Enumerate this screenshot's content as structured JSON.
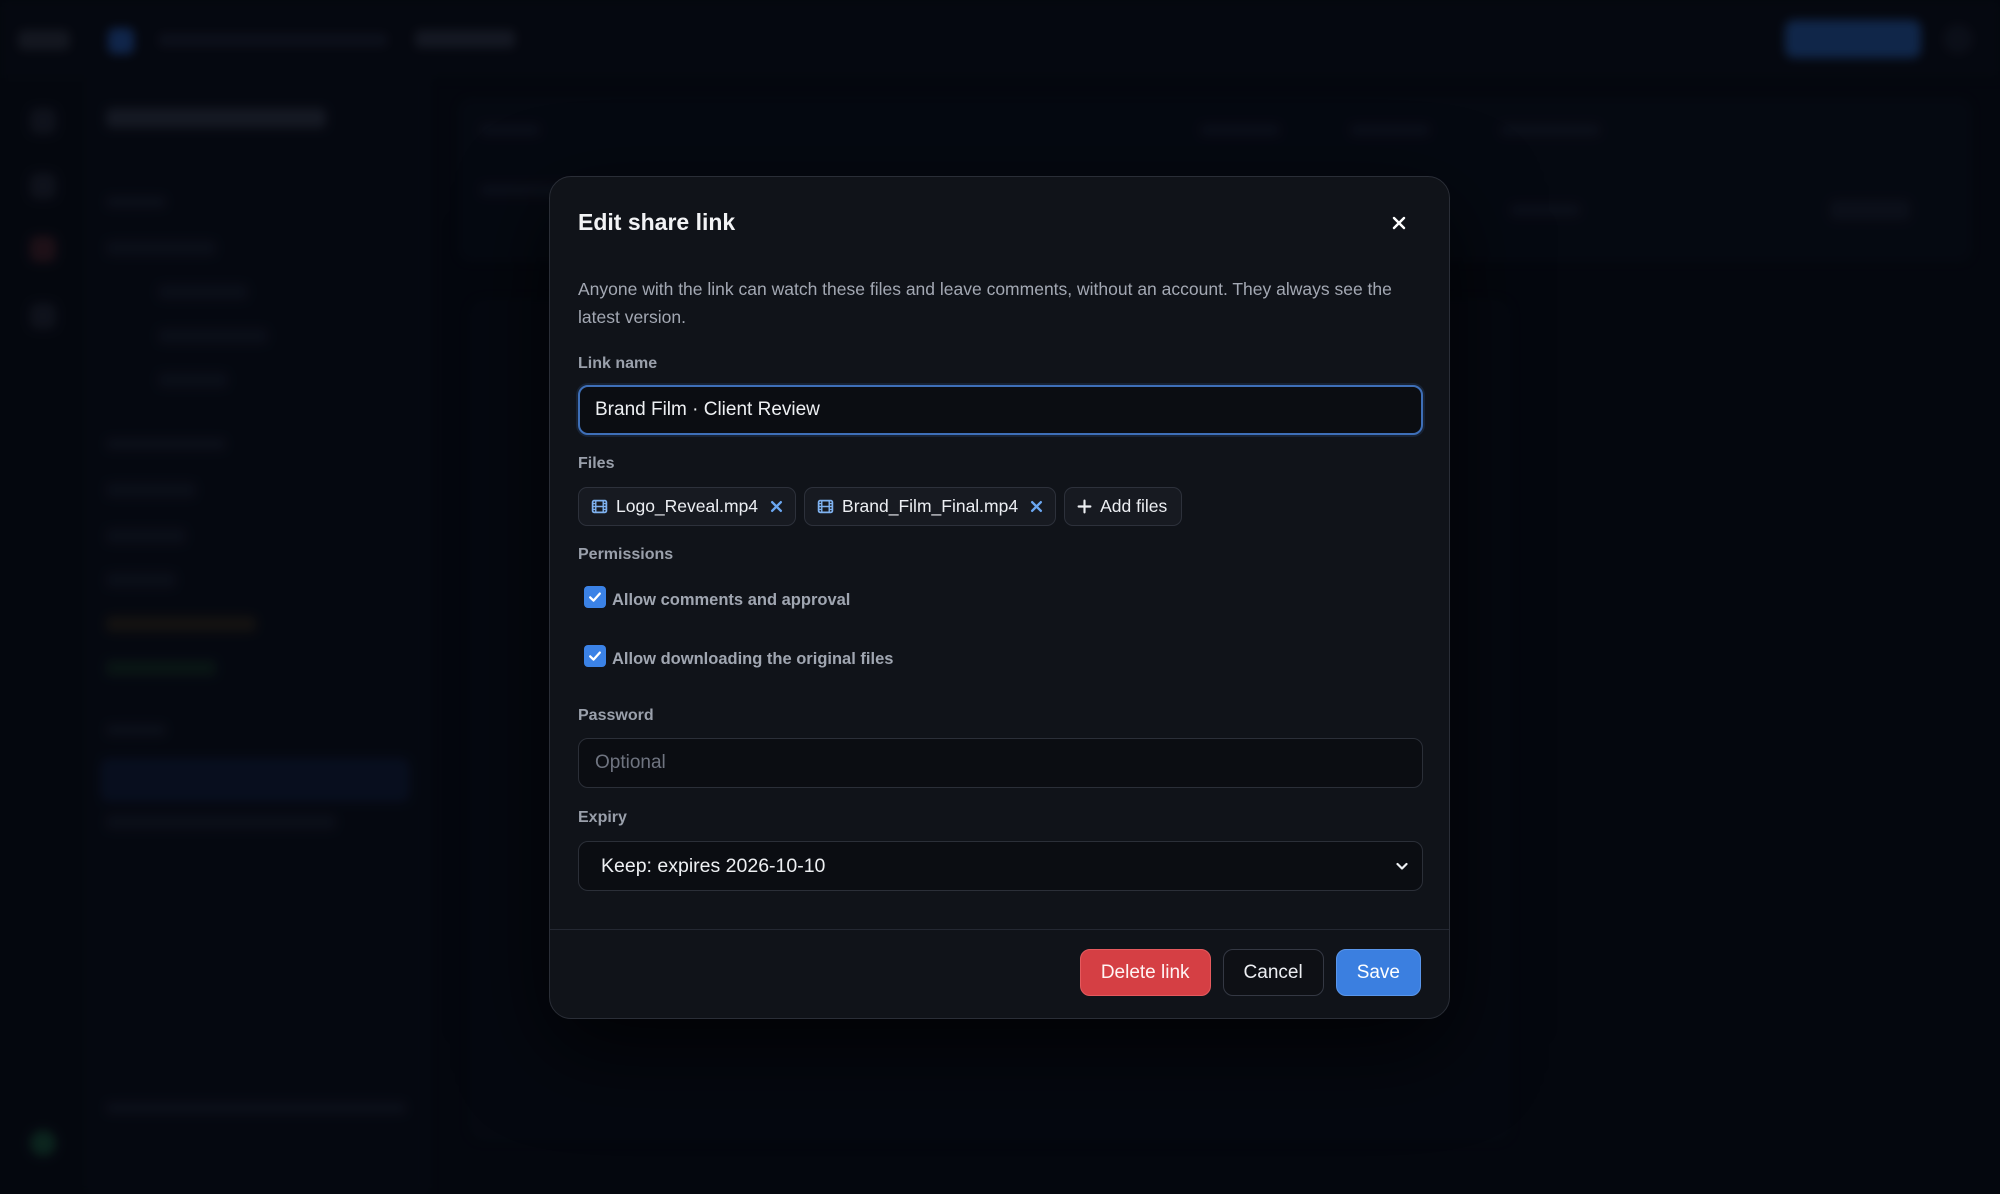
{
  "modal": {
    "title": "Edit share link",
    "description": "Anyone with the link can watch these files and leave comments, without an account. They always see the latest version.",
    "link_name": {
      "label": "Link name",
      "value": "Brand Film · Client Review"
    },
    "files": {
      "label": "Files",
      "items": [
        {
          "name": "Logo_Reveal.mp4"
        },
        {
          "name": "Brand_Film_Final.mp4"
        }
      ],
      "add_label": "Add files"
    },
    "permissions": {
      "label": "Permissions",
      "options": [
        {
          "label": "Allow comments and approval",
          "checked": true
        },
        {
          "label": "Allow downloading the original files",
          "checked": true
        }
      ]
    },
    "password": {
      "label": "Password",
      "value": "",
      "placeholder": "Optional"
    },
    "expiry": {
      "label": "Expiry",
      "selected": "Keep: expires 2026-10-10"
    },
    "actions": {
      "delete": "Delete link",
      "cancel": "Cancel",
      "save": "Save"
    }
  },
  "colors": {
    "accent": "#3b7fe0",
    "danger": "#d53f44",
    "surface": "#101319",
    "backdrop": "#070a12",
    "file_icon": "#7fb2f0"
  },
  "icons": {
    "close": "close-icon",
    "file": "film-icon",
    "remove": "x-icon",
    "add": "plus-icon",
    "check": "check-icon",
    "select": "chevron-down-icon"
  }
}
